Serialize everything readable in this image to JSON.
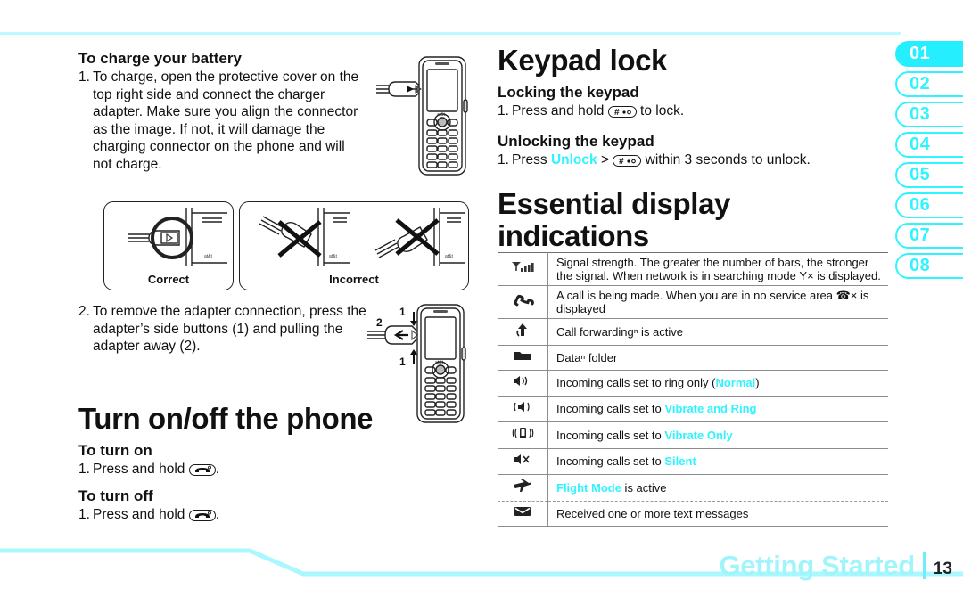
{
  "document": {
    "page_number": "13",
    "footer_title": "Getting Started",
    "accent_cyan": "#2ff3ff",
    "footer_cyan": "#9ff5fb"
  },
  "tabs": [
    {
      "label": "01",
      "active": true
    },
    {
      "label": "02",
      "active": false
    },
    {
      "label": "03",
      "active": false
    },
    {
      "label": "04",
      "active": false
    },
    {
      "label": "05",
      "active": false
    },
    {
      "label": "06",
      "active": false
    },
    {
      "label": "07",
      "active": false
    },
    {
      "label": "08",
      "active": false
    }
  ],
  "left_column": {
    "charge_heading": "To charge your battery",
    "charge_step_num": "1.",
    "charge_step_text": "To charge, open the protective cover on the top right side and connect the charger adapter. Make sure you align the connector as the image. If not, it will damage the charging connector on the phone and will not charge.",
    "diagram_correct_caption": "Correct",
    "diagram_incorrect_caption": "Incorrect",
    "remove_step_num": "2.",
    "remove_step_text": "To remove the adapter connection, press the adapter’s side buttons (1) and pulling the adapter away (2).",
    "callout_1a": "1",
    "callout_1b": "1",
    "callout_2": "2",
    "turn_heading": "Turn on/off the phone",
    "turn_on_heading": "To turn on",
    "turn_on_step_num": "1.",
    "turn_on_step_prefix": "Press and hold",
    "turn_on_step_suffix": ".",
    "turn_off_heading": "To turn off",
    "turn_off_step_num": "1.",
    "turn_off_step_prefix": "Press and hold",
    "turn_off_step_suffix": "."
  },
  "right_column": {
    "keypad_lock_heading": "Keypad lock",
    "locking_heading": "Locking the keypad",
    "locking_step_num": "1.",
    "locking_step_prefix": "Press and hold",
    "locking_step_suffix": "to lock.",
    "unlocking_heading": "Unlocking the keypad",
    "unlocking_step_num": "1.",
    "unlocking_step_prefix": "Press",
    "unlocking_link": "Unlock",
    "unlocking_gt": ">",
    "unlocking_step_suffix": "within 3 seconds to unlock.",
    "essential_heading": "Essential display indications"
  },
  "indications": [
    {
      "icon": "signal-strength-icon",
      "text_parts": [
        {
          "t": "Signal strength. The greater the number of bars, the stronger the signal. When network is in searching mode ",
          "style": "plain"
        },
        {
          "t": "Υ×",
          "style": "inline-icon"
        },
        {
          "t": " is displayed.",
          "style": "plain"
        }
      ],
      "plain": "Signal strength. The greater the number of bars, the stronger the signal. When network is in searching mode Υ× is displayed."
    },
    {
      "icon": "handset-call-icon",
      "plain": "A call is being made. When you are in no service area ☎× is displayed"
    },
    {
      "icon": "call-forwarding-arrow-icon",
      "plain": "Call forwardingⁿ is active"
    },
    {
      "icon": "folder-icon",
      "plain": "Dataⁿ folder"
    },
    {
      "icon": "speaker-ring-icon",
      "plain_pre": "Incoming calls set to ring only (",
      "highlight": "Normal",
      "plain_post": ")"
    },
    {
      "icon": "vibrate-and-ring-icon",
      "plain_pre": "Incoming calls set to ",
      "highlight": "Vibrate and Ring",
      "plain_post": ""
    },
    {
      "icon": "vibrate-only-icon",
      "plain_pre": "Incoming calls set to ",
      "highlight": "Vibrate Only",
      "plain_post": ""
    },
    {
      "icon": "speaker-mute-icon",
      "plain_pre": "Incoming calls set to ",
      "highlight": "Silent",
      "plain_post": ""
    },
    {
      "icon": "airplane-icon",
      "plain_pre": "",
      "highlight": "Flight Mode",
      "plain_post": " is active"
    },
    {
      "icon": "envelope-icon",
      "plain": "Received one or more text messages"
    }
  ]
}
